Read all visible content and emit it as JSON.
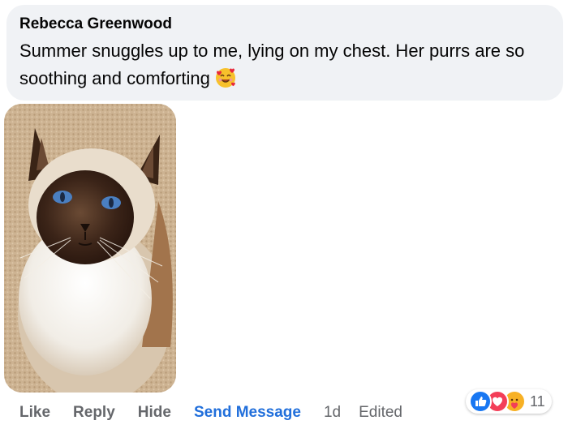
{
  "comment": {
    "author": "Rebecca Greenwood",
    "text": "Summer snuggles up to me, lying on my chest. Her purrs are so soothing and comforting",
    "emoji_icon": "smiling-face-with-hearts-icon"
  },
  "actions": {
    "like": "Like",
    "reply": "Reply",
    "hide": "Hide",
    "send_message": "Send Message",
    "time": "1d",
    "edited": "Edited"
  },
  "reactions": {
    "icons": [
      "like-icon",
      "love-icon",
      "care-icon"
    ],
    "count": "11"
  },
  "colors": {
    "bubble_bg": "#f0f2f5",
    "link_blue": "#216fdb",
    "secondary_text": "#65676b",
    "like_blue": "#1877f2",
    "love_red": "#f33e58",
    "care_yellow": "#f7b125"
  }
}
